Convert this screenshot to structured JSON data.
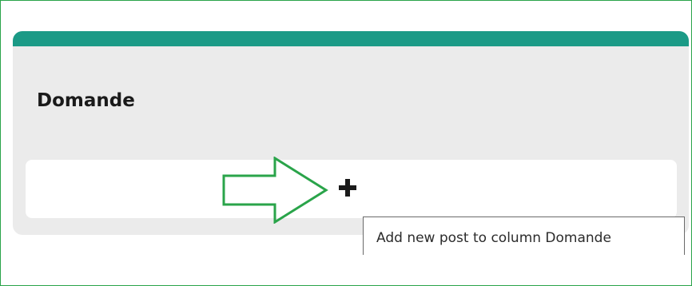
{
  "column": {
    "title": "Domande",
    "header_color": "#1b9a86",
    "background_color": "#ebebeb"
  },
  "add_post": {
    "icon": "plus-icon",
    "tooltip": "Add new post to column Domande"
  },
  "annotation": {
    "icon": "arrow-right-outline-icon",
    "color": "#2aa44a"
  }
}
